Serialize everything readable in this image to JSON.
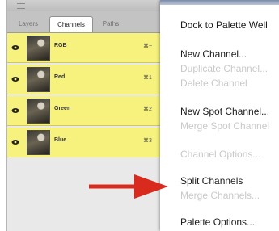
{
  "palette": {
    "tabs": {
      "layers": "Layers",
      "channels": "Channels",
      "paths": "Paths"
    },
    "channels": [
      {
        "name": "RGB",
        "shortcut": "⌘~"
      },
      {
        "name": "Red",
        "shortcut": "⌘1"
      },
      {
        "name": "Green",
        "shortcut": "⌘2"
      },
      {
        "name": "Blue",
        "shortcut": "⌘3"
      }
    ],
    "row_highlight_color": "#f6f27d"
  },
  "menu": {
    "items": [
      {
        "label": "Dock to Palette Well",
        "enabled": true
      },
      {
        "label": "New Channel...",
        "enabled": true
      },
      {
        "label": "Duplicate Channel...",
        "enabled": false
      },
      {
        "label": "Delete Channel",
        "enabled": false
      },
      {
        "label": "New Spot Channel...",
        "enabled": true
      },
      {
        "label": "Merge Spot Channel",
        "enabled": false
      },
      {
        "label": "Channel Options...",
        "enabled": false
      },
      {
        "label": "Split Channels",
        "enabled": true
      },
      {
        "label": "Merge Channels...",
        "enabled": false
      },
      {
        "label": "Palette Options...",
        "enabled": true
      }
    ]
  },
  "annotation": {
    "arrow_color": "#d82b1e",
    "points_to": "Split Channels"
  }
}
